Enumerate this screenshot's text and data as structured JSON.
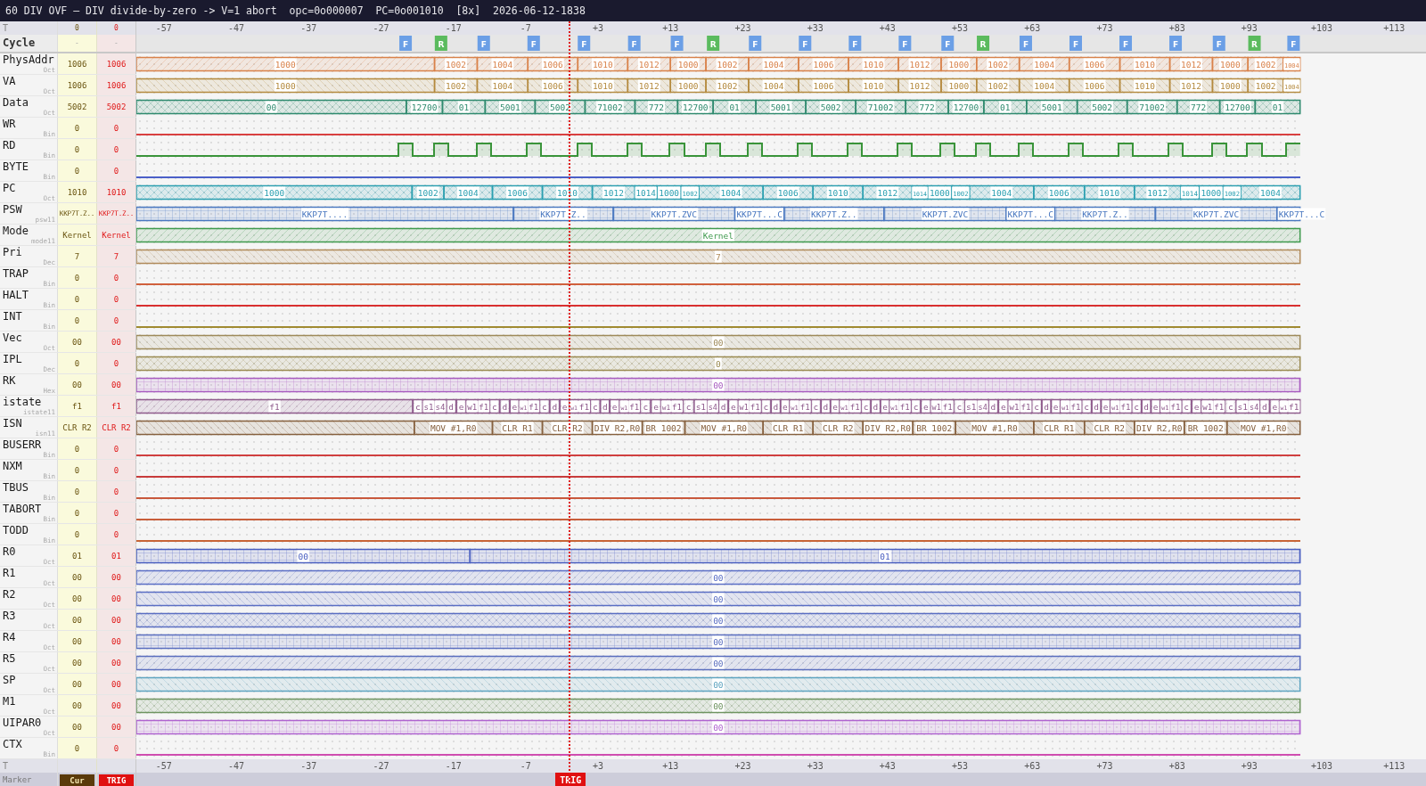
{
  "title": "60 DIV OVF — DIV divide-by-zero -> V=1 abort  opc=0o000007  PC=0o001010  [8x]  2026-06-12-1838",
  "time_axis": {
    "top_label": "T",
    "cursor_time": "0",
    "trigger_time": "0",
    "top_ticks": [
      "-57",
      "-47",
      "-37",
      "-27",
      "-17",
      "-7",
      "+3",
      "+13",
      "+23",
      "+33",
      "+43",
      "+53",
      "+63",
      "+73",
      "+83",
      "+93",
      "+103",
      "+113"
    ],
    "bottom_label": "T",
    "bottom_ticks": [
      "-57",
      "-47",
      "-37",
      "-27",
      "-17",
      "-7",
      "+3",
      "+13",
      "+23",
      "+33",
      "+43",
      "+53",
      "+63",
      "+73",
      "+83",
      "+93",
      "+103",
      "+113"
    ]
  },
  "cycle_row": {
    "name": "Cycle",
    "cursor": "-",
    "trigger": "-",
    "cycles": [
      {
        "kind": "fetch",
        "label": "F"
      },
      {
        "kind": "read",
        "label": "R"
      },
      {
        "kind": "fetch",
        "label": "F"
      },
      {
        "kind": "fetch",
        "label": "F"
      },
      {
        "kind": "fetch",
        "label": "F"
      },
      {
        "kind": "fetch",
        "label": "F"
      },
      {
        "kind": "fetch",
        "label": "F"
      },
      {
        "kind": "read",
        "label": "R"
      },
      {
        "kind": "fetch",
        "label": "F"
      },
      {
        "kind": "fetch",
        "label": "F"
      },
      {
        "kind": "fetch",
        "label": "F"
      },
      {
        "kind": "fetch",
        "label": "F"
      },
      {
        "kind": "fetch",
        "label": "F"
      },
      {
        "kind": "read",
        "label": "R"
      },
      {
        "kind": "fetch",
        "label": "F"
      },
      {
        "kind": "fetch",
        "label": "F"
      },
      {
        "kind": "fetch",
        "label": "F"
      },
      {
        "kind": "fetch",
        "label": "F"
      },
      {
        "kind": "fetch",
        "label": "F"
      },
      {
        "kind": "read",
        "label": "R"
      },
      {
        "kind": "fetch",
        "label": "F"
      }
    ]
  },
  "signals": [
    {
      "name": "PhysAddr",
      "format": "Oct",
      "cursor": "1006",
      "trigger": "1006",
      "kind": "bus",
      "color": "#d9824a",
      "segments": [
        {
          "label": "1000"
        },
        {
          "label": "1002"
        },
        {
          "label": "1004"
        },
        {
          "label": "1006"
        },
        {
          "label": "1010"
        },
        {
          "label": "1012"
        },
        {
          "label": "1000"
        },
        {
          "label": "1002"
        },
        {
          "label": "1004"
        },
        {
          "label": "1006"
        },
        {
          "label": "1010"
        },
        {
          "label": "1012"
        },
        {
          "label": "1000"
        },
        {
          "label": "1002"
        },
        {
          "label": "1004"
        },
        {
          "label": "1006"
        },
        {
          "label": "1010"
        },
        {
          "label": "1012"
        },
        {
          "label": "1000"
        },
        {
          "label": "1002"
        },
        {
          "label": "1004"
        }
      ]
    },
    {
      "name": "VA",
      "format": "Oct",
      "cursor": "1006",
      "trigger": "1006",
      "kind": "bus",
      "color": "#b48a3e",
      "segments": [
        {
          "label": "1000"
        },
        {
          "label": "1002"
        },
        {
          "label": "1004"
        },
        {
          "label": "1006"
        },
        {
          "label": "1010"
        },
        {
          "label": "1012"
        },
        {
          "label": "1000"
        },
        {
          "label": "1002"
        },
        {
          "label": "1004"
        },
        {
          "label": "1006"
        },
        {
          "label": "1010"
        },
        {
          "label": "1012"
        },
        {
          "label": "1000"
        },
        {
          "label": "1002"
        },
        {
          "label": "1004"
        },
        {
          "label": "1006"
        },
        {
          "label": "1010"
        },
        {
          "label": "1012"
        },
        {
          "label": "1000"
        },
        {
          "label": "1002"
        },
        {
          "label": "1004"
        }
      ]
    },
    {
      "name": "Data",
      "format": "Oct",
      "cursor": "5002",
      "trigger": "5002",
      "kind": "bus",
      "color": "#2e8a6e",
      "segments": [
        {
          "label": "00"
        },
        {
          "label": "12700"
        },
        {
          "label": "01"
        },
        {
          "label": "5001"
        },
        {
          "label": "5002"
        },
        {
          "label": "71002"
        },
        {
          "label": "772"
        },
        {
          "label": "12700"
        },
        {
          "label": "01"
        },
        {
          "label": "5001"
        },
        {
          "label": "5002"
        },
        {
          "label": "71002"
        },
        {
          "label": "772"
        },
        {
          "label": "12700"
        },
        {
          "label": "01"
        },
        {
          "label": "5001"
        },
        {
          "label": "5002"
        },
        {
          "label": "71002"
        },
        {
          "label": "772"
        },
        {
          "label": "12700"
        },
        {
          "label": "01"
        }
      ]
    },
    {
      "name": "WR",
      "format": "Bin",
      "cursor": "0",
      "trigger": "0",
      "kind": "bit",
      "color": "#d94040",
      "segments": [
        {
          "high": false
        }
      ]
    },
    {
      "name": "RD",
      "format": "Bin",
      "cursor": "0",
      "trigger": "0",
      "kind": "bit",
      "color": "#3a943a",
      "segments": [
        {
          "high": false
        },
        {
          "high": true
        },
        {
          "high": false
        },
        {
          "high": true
        },
        {
          "high": false
        },
        {
          "high": true
        },
        {
          "high": false
        },
        {
          "high": true
        },
        {
          "high": false
        },
        {
          "high": true
        },
        {
          "high": false
        },
        {
          "high": true
        },
        {
          "high": false
        },
        {
          "high": true
        },
        {
          "high": false
        },
        {
          "high": true
        },
        {
          "high": false
        },
        {
          "high": true
        },
        {
          "high": false
        },
        {
          "high": true
        },
        {
          "high": false
        },
        {
          "high": true
        },
        {
          "high": false
        },
        {
          "high": true
        },
        {
          "high": false
        },
        {
          "high": true
        },
        {
          "high": false
        },
        {
          "high": true
        },
        {
          "high": false
        },
        {
          "high": true
        },
        {
          "high": false
        },
        {
          "high": true
        },
        {
          "high": false
        },
        {
          "high": true
        },
        {
          "high": false
        },
        {
          "high": true
        },
        {
          "high": false
        },
        {
          "high": true
        },
        {
          "high": false
        },
        {
          "high": true
        },
        {
          "high": false
        },
        {
          "high": true
        }
      ]
    },
    {
      "name": "BYTE",
      "format": "Bin",
      "cursor": "0",
      "trigger": "0",
      "kind": "bit",
      "color": "#4b5fc8",
      "segments": [
        {
          "high": false
        }
      ]
    },
    {
      "name": "PC",
      "format": "Oct",
      "cursor": "1010",
      "trigger": "1010",
      "kind": "bus",
      "color": "#2a9fb0",
      "segments": [
        {
          "label": "1000"
        },
        {
          "label": "1002"
        },
        {
          "label": "1004"
        },
        {
          "label": "1006"
        },
        {
          "label": "1010"
        },
        {
          "label": "1012"
        },
        {
          "label": "1014"
        },
        {
          "label": "1000"
        },
        {
          "label": "1002"
        },
        {
          "label": "1004"
        },
        {
          "label": "1006"
        },
        {
          "label": "1010"
        },
        {
          "label": "1012"
        },
        {
          "label": "1014"
        },
        {
          "label": "1000"
        },
        {
          "label": "1002"
        },
        {
          "label": "1004"
        },
        {
          "label": "1006"
        },
        {
          "label": "1010"
        },
        {
          "label": "1012"
        },
        {
          "label": "1014"
        },
        {
          "label": "1000"
        },
        {
          "label": "1002"
        },
        {
          "label": "1004"
        }
      ]
    },
    {
      "name": "PSW",
      "format": "psw11",
      "cursor": "KKP7T.Z..",
      "trigger": "KKP7T.Z..",
      "kind": "bus",
      "color": "#4a78c0",
      "segments": [
        {
          "label": "KKP7T...."
        },
        {
          "label": "KKP7T.Z.."
        },
        {
          "label": "KKP7T.ZVC"
        },
        {
          "label": "KKP7T...C"
        },
        {
          "label": "KKP7T.Z.."
        },
        {
          "label": "KKP7T.ZVC"
        },
        {
          "label": "KKP7T...C"
        },
        {
          "label": "KKP7T.Z.."
        },
        {
          "label": "KKP7T.ZVC"
        },
        {
          "label": "KKP7T...C"
        }
      ]
    },
    {
      "name": "Mode",
      "format": "mode11",
      "cursor": "Kernel",
      "trigger": "Kernel",
      "kind": "bus",
      "color": "#3f9a4e",
      "segments": [
        {
          "label": "Kernel"
        }
      ]
    },
    {
      "name": "Pri",
      "format": "Dec",
      "cursor": "7",
      "trigger": "7",
      "kind": "bus",
      "color": "#b08a5a",
      "segments": [
        {
          "label": "7"
        }
      ]
    },
    {
      "name": "TRAP",
      "format": "Bin",
      "cursor": "0",
      "trigger": "0",
      "kind": "bit",
      "color": "#d0603c",
      "segments": [
        {
          "high": false
        }
      ]
    },
    {
      "name": "HALT",
      "format": "Bin",
      "cursor": "0",
      "trigger": "0",
      "kind": "bit",
      "color": "#d93030",
      "segments": [
        {
          "high": false
        }
      ]
    },
    {
      "name": "INT",
      "format": "Bin",
      "cursor": "0",
      "trigger": "0",
      "kind": "bit",
      "color": "#a08a30",
      "segments": [
        {
          "high": false
        }
      ]
    },
    {
      "name": "Vec",
      "format": "Oct",
      "cursor": "00",
      "trigger": "00",
      "kind": "bus",
      "color": "#9e8a5a",
      "segments": [
        {
          "label": "00"
        }
      ]
    },
    {
      "name": "IPL",
      "format": "Dec",
      "cursor": "0",
      "trigger": "0",
      "kind": "bus",
      "color": "#9a8a50",
      "segments": [
        {
          "label": "0"
        }
      ]
    },
    {
      "name": "RK",
      "format": "Hex",
      "cursor": "00",
      "trigger": "00",
      "kind": "bus",
      "color": "#a85cc0",
      "segments": [
        {
          "label": "00"
        }
      ]
    },
    {
      "name": "istate",
      "format": "istate11",
      "cursor": "f1",
      "trigger": "f1",
      "kind": "bus",
      "color": "#8e5a8c",
      "segments": [
        {
          "label": "f1"
        },
        {
          "label": "c"
        },
        {
          "label": "s1"
        },
        {
          "label": "s4"
        },
        {
          "label": "d"
        },
        {
          "label": "e"
        },
        {
          "label": "w1"
        },
        {
          "label": "f1"
        },
        {
          "label": "c"
        },
        {
          "label": "d"
        },
        {
          "label": "e"
        },
        {
          "label": "w1"
        },
        {
          "label": "f1"
        },
        {
          "label": "c"
        },
        {
          "label": "d"
        },
        {
          "label": "e"
        },
        {
          "label": "w1"
        },
        {
          "label": "f1"
        },
        {
          "label": "c"
        },
        {
          "label": "d"
        },
        {
          "label": "e"
        },
        {
          "label": "w1"
        },
        {
          "label": "f1"
        },
        {
          "label": "c"
        },
        {
          "label": "e"
        },
        {
          "label": "w1"
        },
        {
          "label": "f1"
        },
        {
          "label": "c"
        },
        {
          "label": "s1"
        },
        {
          "label": "s4"
        },
        {
          "label": "d"
        },
        {
          "label": "e"
        },
        {
          "label": "w1"
        },
        {
          "label": "f1"
        },
        {
          "label": "c"
        },
        {
          "label": "d"
        },
        {
          "label": "e"
        },
        {
          "label": "w1"
        },
        {
          "label": "f1"
        },
        {
          "label": "c"
        },
        {
          "label": "d"
        },
        {
          "label": "e"
        },
        {
          "label": "w1"
        },
        {
          "label": "f1"
        },
        {
          "label": "c"
        },
        {
          "label": "d"
        },
        {
          "label": "e"
        },
        {
          "label": "w1"
        },
        {
          "label": "f1"
        },
        {
          "label": "c"
        },
        {
          "label": "e"
        },
        {
          "label": "w1"
        },
        {
          "label": "f1"
        },
        {
          "label": "c"
        },
        {
          "label": "s1"
        },
        {
          "label": "s4"
        },
        {
          "label": "d"
        },
        {
          "label": "e"
        },
        {
          "label": "w1"
        },
        {
          "label": "f1"
        },
        {
          "label": "c"
        },
        {
          "label": "d"
        },
        {
          "label": "e"
        },
        {
          "label": "w1"
        },
        {
          "label": "f1"
        },
        {
          "label": "c"
        },
        {
          "label": "d"
        },
        {
          "label": "e"
        },
        {
          "label": "w1"
        },
        {
          "label": "f1"
        },
        {
          "label": "c"
        },
        {
          "label": "d"
        },
        {
          "label": "e"
        },
        {
          "label": "w1"
        },
        {
          "label": "f1"
        },
        {
          "label": "c"
        },
        {
          "label": "e"
        },
        {
          "label": "w1"
        },
        {
          "label": "f1"
        },
        {
          "label": "c"
        },
        {
          "label": "s1"
        },
        {
          "label": "s4"
        },
        {
          "label": "d"
        },
        {
          "label": "e"
        },
        {
          "label": "w1"
        },
        {
          "label": "f1"
        }
      ]
    },
    {
      "name": "ISN",
      "format": "isn11",
      "cursor": "CLR R2",
      "trigger": "CLR R2",
      "kind": "bus",
      "color": "#86603e",
      "segments": [
        {
          "label": "MOV #1,R0"
        },
        {
          "label": "CLR R1"
        },
        {
          "label": "CLR R2"
        },
        {
          "label": "DIV R2,R0"
        },
        {
          "label": "BR 1002"
        },
        {
          "label": "MOV #1,R0"
        },
        {
          "label": "CLR R1"
        },
        {
          "label": "CLR R2"
        },
        {
          "label": "DIV R2,R0"
        },
        {
          "label": "BR 1002"
        },
        {
          "label": "MOV #1,R0"
        },
        {
          "label": "CLR R1"
        },
        {
          "label": "CLR R2"
        },
        {
          "label": "DIV R2,R0"
        },
        {
          "label": "BR 1002"
        },
        {
          "label": "MOV #1,R0"
        }
      ]
    },
    {
      "name": "BUSERR",
      "format": "Bin",
      "cursor": "0",
      "trigger": "0",
      "kind": "bit",
      "color": "#d04040",
      "segments": [
        {
          "high": false
        }
      ]
    },
    {
      "name": "NXM",
      "format": "Bin",
      "cursor": "0",
      "trigger": "0",
      "kind": "bit",
      "color": "#c83c3c",
      "segments": [
        {
          "high": false
        }
      ]
    },
    {
      "name": "TBUS",
      "format": "Bin",
      "cursor": "0",
      "trigger": "0",
      "kind": "bit",
      "color": "#c8583c",
      "segments": [
        {
          "high": false
        }
      ]
    },
    {
      "name": "TABORT",
      "format": "Bin",
      "cursor": "0",
      "trigger": "0",
      "kind": "bit",
      "color": "#c85e3a",
      "segments": [
        {
          "high": false
        }
      ]
    },
    {
      "name": "TODD",
      "format": "Bin",
      "cursor": "0",
      "trigger": "0",
      "kind": "bit",
      "color": "#c86436",
      "segments": [
        {
          "high": false
        }
      ]
    },
    {
      "name": "R0",
      "format": "Oct",
      "cursor": "01",
      "trigger": "01",
      "kind": "bus",
      "color": "#4a5fc0",
      "segments": [
        {
          "label": "00"
        },
        {
          "label": "01"
        }
      ]
    },
    {
      "name": "R1",
      "format": "Oct",
      "cursor": "00",
      "trigger": "00",
      "kind": "bus",
      "color": "#5a6ec6",
      "segments": [
        {
          "label": "00"
        }
      ]
    },
    {
      "name": "R2",
      "format": "Oct",
      "cursor": "00",
      "trigger": "00",
      "kind": "bus",
      "color": "#5a6ec4",
      "segments": [
        {
          "label": "00"
        }
      ]
    },
    {
      "name": "R3",
      "format": "Oct",
      "cursor": "00",
      "trigger": "00",
      "kind": "bus",
      "color": "#5a6ec2",
      "segments": [
        {
          "label": "00"
        }
      ]
    },
    {
      "name": "R4",
      "format": "Oct",
      "cursor": "00",
      "trigger": "00",
      "kind": "bus",
      "color": "#5a6ec0",
      "segments": [
        {
          "label": "00"
        }
      ]
    },
    {
      "name": "R5",
      "format": "Oct",
      "cursor": "00",
      "trigger": "00",
      "kind": "bus",
      "color": "#5a6ebe",
      "segments": [
        {
          "label": "00"
        }
      ]
    },
    {
      "name": "SP",
      "format": "Oct",
      "cursor": "00",
      "trigger": "00",
      "kind": "bus",
      "color": "#5ea4c0",
      "segments": [
        {
          "label": "00"
        }
      ]
    },
    {
      "name": "M1",
      "format": "Oct",
      "cursor": "00",
      "trigger": "00",
      "kind": "bus",
      "color": "#6e9460",
      "segments": [
        {
          "label": "00"
        }
      ]
    },
    {
      "name": "UIPAR0",
      "format": "Oct",
      "cursor": "00",
      "trigger": "00",
      "kind": "bus",
      "color": "#b064d0",
      "segments": [
        {
          "label": "00"
        }
      ]
    },
    {
      "name": "CTX",
      "format": "Bin",
      "cursor": "0",
      "trigger": "0",
      "kind": "bit",
      "color": "#d04eb0",
      "segments": [
        {
          "high": false
        }
      ]
    }
  ],
  "marker_row": {
    "label": "Marker",
    "cursor_button": "Cur",
    "trigger_button": "TRIG"
  },
  "trigger": {
    "label": "TRIG"
  }
}
